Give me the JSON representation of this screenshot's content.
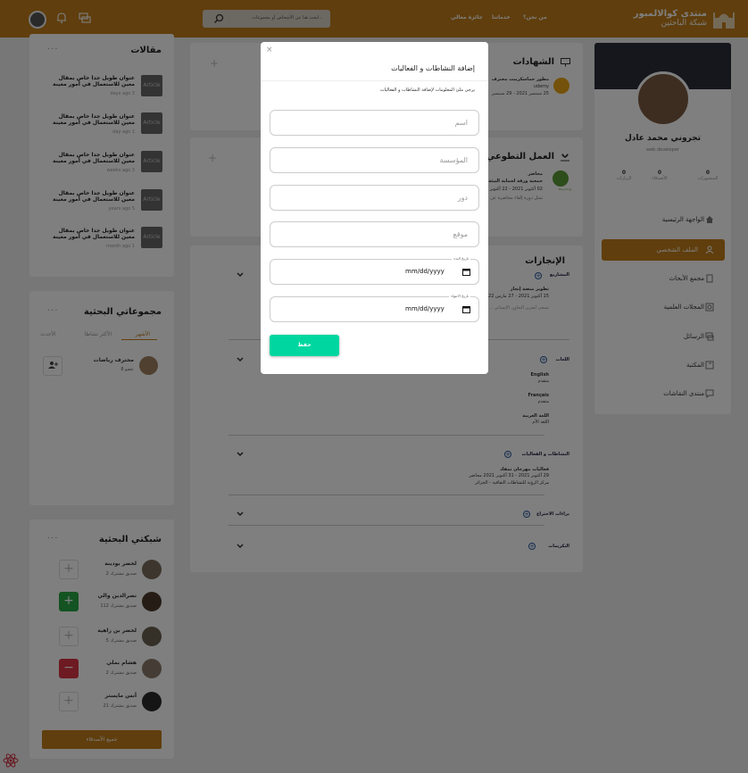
{
  "header": {
    "brand_title": "منتدى كوالالمبور",
    "brand_subtitle": "شبكة الباحثين",
    "nav": [
      "من نحن؟",
      "خدماتنا",
      "جائزة معالي"
    ],
    "search_placeholder": "ابحث هنا عن الأشخاص أو مجموعات..."
  },
  "profile": {
    "name": "تجروني محمد عادل",
    "role": "web developer",
    "stats": [
      {
        "value": "0",
        "label": "المنشورات"
      },
      {
        "value": "0",
        "label": "الأصدقاء"
      },
      {
        "value": "0",
        "label": "الزيارات"
      }
    ],
    "menu": [
      {
        "label": "الواجهة الرئيسية",
        "icon": "home-icon",
        "active": false
      },
      {
        "label": "الملف الشخصي",
        "icon": "user-icon",
        "active": true
      },
      {
        "label": "مجمع الأبحاث",
        "icon": "document-icon",
        "active": false
      },
      {
        "label": "المجلات العلمية",
        "icon": "journal-icon",
        "active": false
      },
      {
        "label": "الرسائل",
        "icon": "messages-icon",
        "active": false
      },
      {
        "label": "المكتبة",
        "icon": "library-icon",
        "active": false
      },
      {
        "label": "منتدى النقاشات",
        "icon": "chat-icon",
        "active": false
      }
    ]
  },
  "certificates": {
    "title": "الشهادات",
    "item_title": "مطور حماسكريبت محترف",
    "item_org": "udemy",
    "item_date": "25 سبتمبر 2021 - 29 سبتمبر"
  },
  "volunteer": {
    "title": "العمل التطوعي",
    "item_role": "محاضر",
    "item_org": "جمعية ورقة لحماية البيئة",
    "item_date": "02 أكتوبر 2021 - 22 أكتوبر 2021",
    "item_desc": "تمثل دورة إلقاء محاضرة عن خطر البلاستيك و إشارة إلى الحلول الممكنة للحد منها و الاستغناء عنه",
    "logo_text": "Recycling"
  },
  "achievements": {
    "title": "الإنجازات",
    "sections": [
      {
        "title": "المشاريع"
      },
      {
        "title": "اللغات"
      },
      {
        "title": "النشاطات و الفعاليات"
      },
      {
        "title": "براءات الاختراع"
      },
      {
        "title": "التكريمات"
      }
    ],
    "project_title": "تطوير منصة إنجاز",
    "project_date": "15 أكتوبر 2021 - 27 مارس 2022",
    "project_desc": "تسعى لتعزيز التعاون الإنساني ... التنمية والريادة",
    "languages": [
      {
        "name": "English",
        "level": "متقدم"
      },
      {
        "name": "Français",
        "level": "متقدم"
      },
      {
        "name": "اللغة العربية",
        "level": "اللغة الأم"
      }
    ],
    "activity_title": "فعاليات مهرجان تمقاد",
    "activity_date": "29 أكتوبر 2021 - 31 أكتوبر 2021 محاضر",
    "activity_place": "مركز الرؤية للنشاطات الثقافية - الجزائر"
  },
  "articles": {
    "title": "مقالات",
    "items": [
      {
        "title": "عنوان طويل جدا خاص بمقال معين للاستعمال في أمور معينة",
        "time": "days ago 3",
        "thumb": "Article"
      },
      {
        "title": "عنوان طويل جدا خاص بمقال معين للاستعمال في أمور معينة",
        "time": "day ago 1",
        "thumb": "Article"
      },
      {
        "title": "عنوان طويل جدا خاص بمقال معين للاستعمال في أمور معينة",
        "time": "weeks ago 3",
        "thumb": "Article"
      },
      {
        "title": "عنوان طويل جدا خاص بمقال معين للاستعمال في أمور معينة",
        "time": "years ago 5",
        "thumb": "Article"
      },
      {
        "title": "عنوان طويل جدا خاص بمقال معين للاستعمال في أمور معينة",
        "time": "month ago 1",
        "thumb": "Article"
      }
    ]
  },
  "groups": {
    "title": "مجموعاتي البحثية",
    "tabs": [
      "الأشهر",
      "الأكثر نشاطا",
      "الأحدث"
    ],
    "item_name": "محترف رياضات",
    "item_members": "عضو 8"
  },
  "network": {
    "title": "شبكتي البحثية",
    "people": [
      {
        "name": "لخضر بودينة",
        "mutual": "صديق مشترك 2",
        "action": "add"
      },
      {
        "name": "نصرالدين والي",
        "mutual": "صديق مشترك 112",
        "action": "added"
      },
      {
        "name": "لخضر بن زاهية",
        "mutual": "صديق مشترك 5",
        "action": "add"
      },
      {
        "name": "هشام بملي",
        "mutual": "صديق مشترك 2",
        "action": "remove"
      },
      {
        "name": "أنس مايستر",
        "mutual": "صديق مشترك 21",
        "action": "add"
      }
    ],
    "all_button": "جميع الأصدقاء"
  },
  "modal": {
    "title": "إضافة النشاطات و الفعاليات",
    "subtitle": "يرجى ملئ المعلومات لإضافة النشاطات و الفعاليات",
    "name_placeholder": "اسم",
    "org_placeholder": "المؤسسة",
    "role_placeholder": "دور",
    "location_placeholder": "موقع",
    "start_label": "تاريخ البدء",
    "end_label": "تاريخ الانتهاء",
    "date_value": "mm/dd/yyyy",
    "save_label": "حفظ",
    "close_symbol": "×"
  },
  "colors": {
    "brand": "#c07d1a",
    "save": "#00d7a0",
    "remove": "#dc3545",
    "add_active": "#28a745"
  }
}
